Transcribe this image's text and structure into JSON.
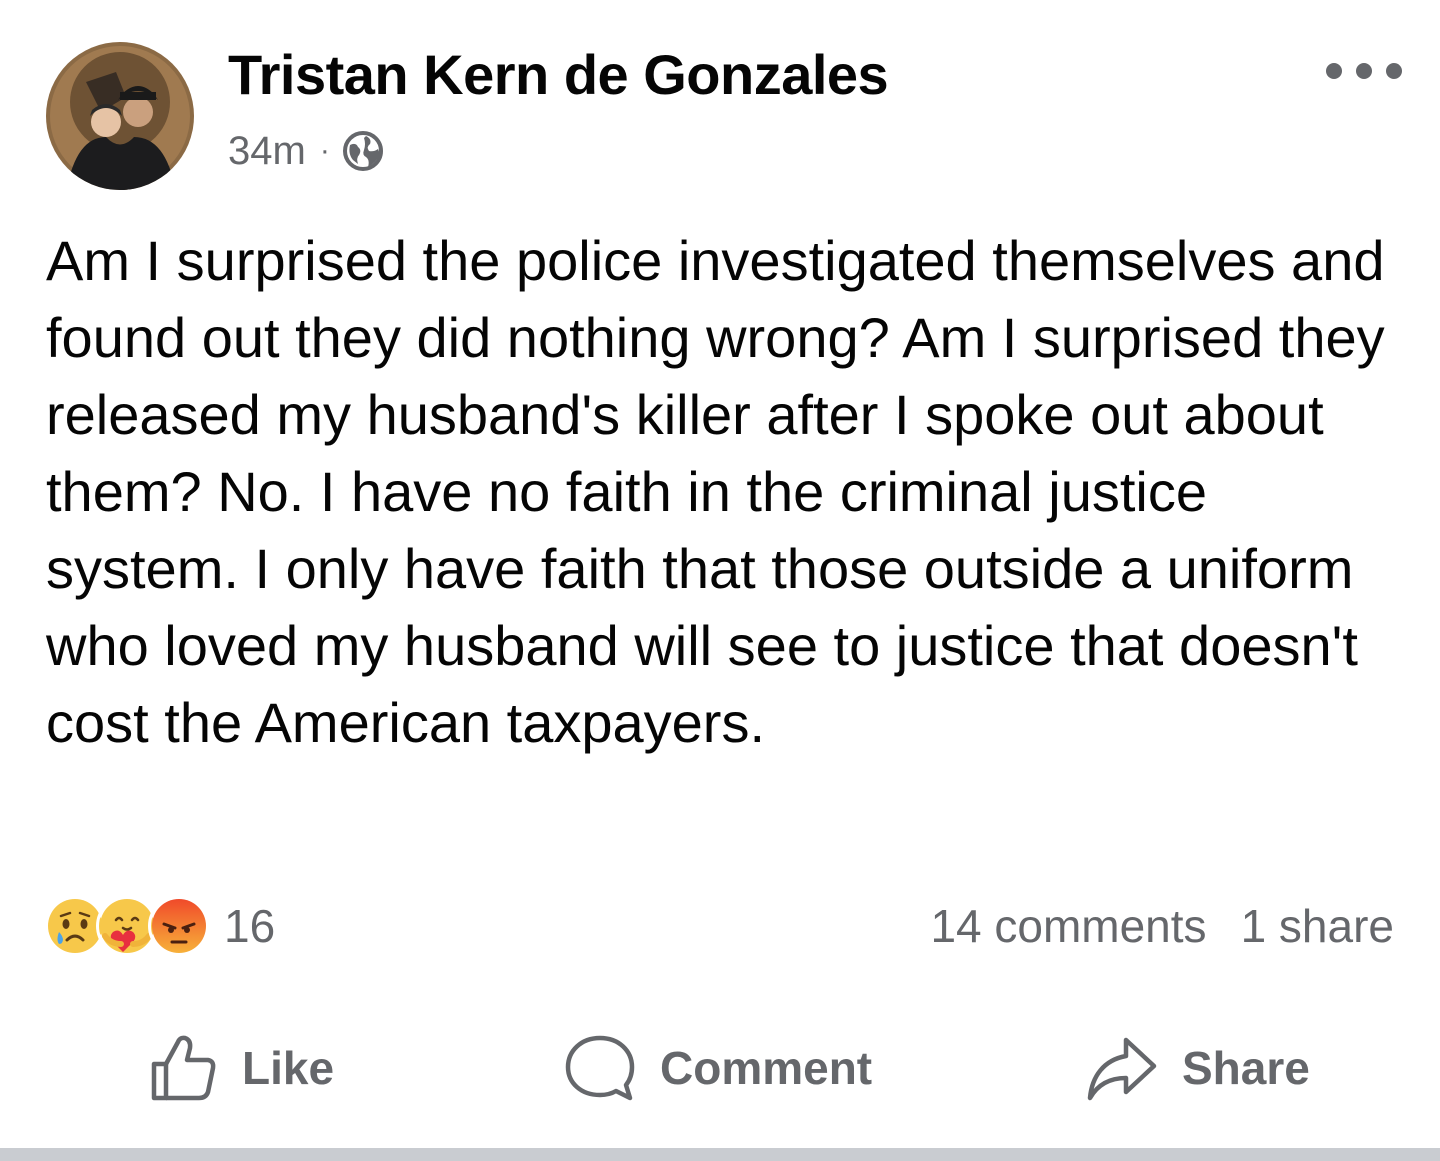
{
  "post": {
    "author_name": "Tristan Kern de Gonzales",
    "timestamp": "34m",
    "separator": "·",
    "audience_icon": "globe-icon",
    "text": "Am I surprised the police investigated themselves and found out they did nothing wrong? Am I surprised they released my husband's killer after I spoke out about them? No. I have no faith in the criminal justice system. I only have faith that those outside a uniform who loved my husband will see to justice that doesn't cost the American taxpayers."
  },
  "reactions": {
    "icons": [
      "sad-emoji-icon",
      "care-emoji-icon",
      "angry-emoji-icon"
    ],
    "count": "16"
  },
  "stats": {
    "comments": "14 comments",
    "shares": "1 share"
  },
  "actions": {
    "like_label": "Like",
    "comment_label": "Comment",
    "share_label": "Share"
  },
  "colors": {
    "text_primary": "#050505",
    "text_secondary": "#65676b",
    "divider": "#c9ccd1"
  }
}
